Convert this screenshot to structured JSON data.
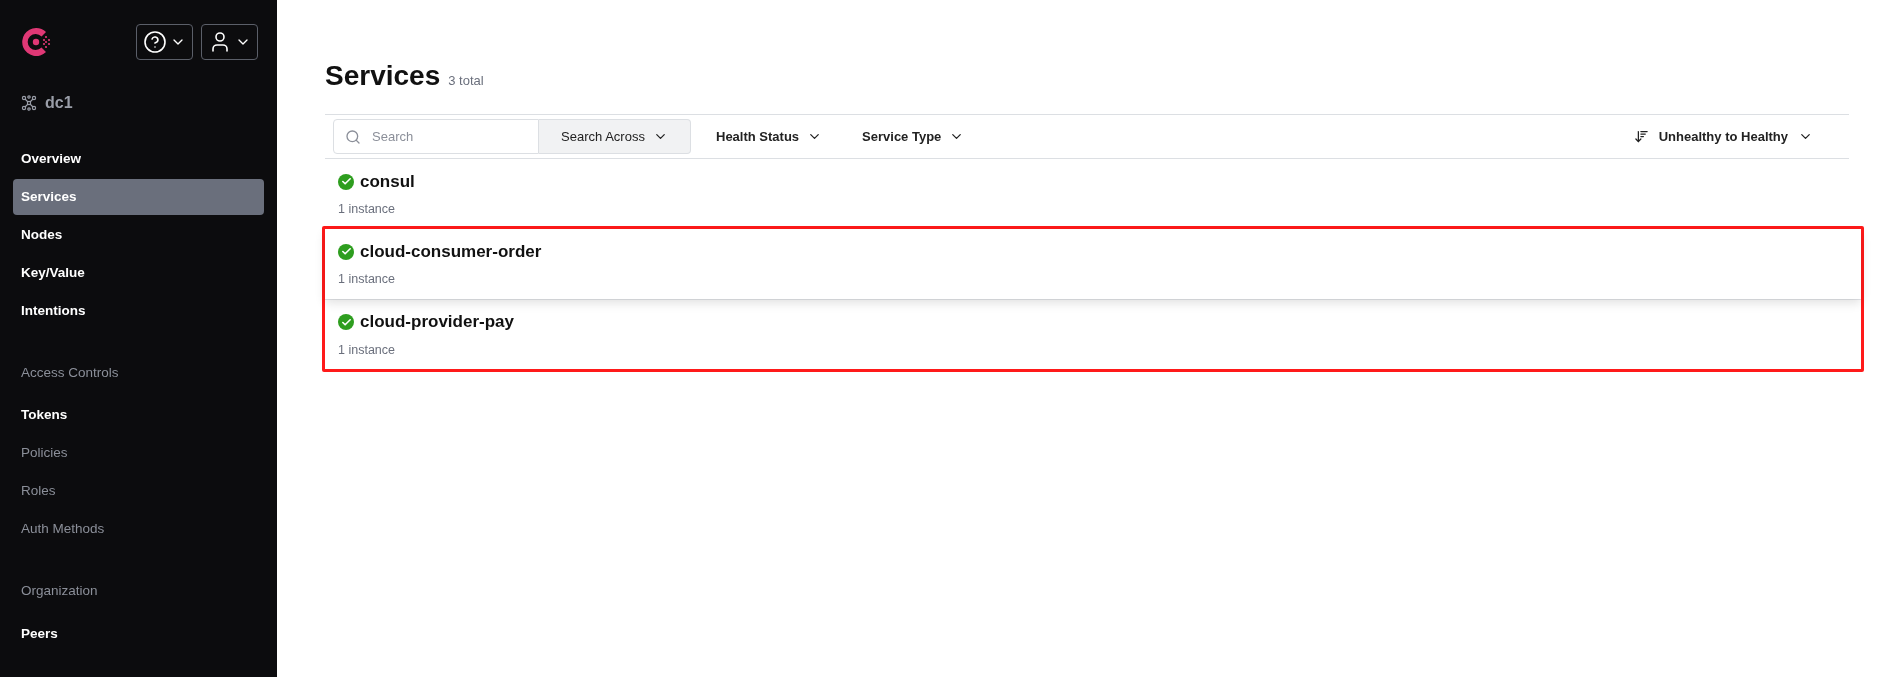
{
  "sidebar": {
    "datacenter": "dc1",
    "items": [
      {
        "kind": "link",
        "label": "Overview",
        "selected": false,
        "disabled": false
      },
      {
        "kind": "link",
        "label": "Services",
        "selected": true,
        "disabled": false
      },
      {
        "kind": "link",
        "label": "Nodes",
        "selected": false,
        "disabled": false
      },
      {
        "kind": "link",
        "label": "Key/Value",
        "selected": false,
        "disabled": false
      },
      {
        "kind": "link",
        "label": "Intentions",
        "selected": false,
        "disabled": false
      },
      {
        "kind": "header",
        "label": "Access Controls"
      },
      {
        "kind": "link",
        "label": "Tokens",
        "selected": false,
        "disabled": false
      },
      {
        "kind": "link",
        "label": "Policies",
        "selected": false,
        "disabled": true
      },
      {
        "kind": "link",
        "label": "Roles",
        "selected": false,
        "disabled": true
      },
      {
        "kind": "link",
        "label": "Auth Methods",
        "selected": false,
        "disabled": true
      },
      {
        "kind": "header",
        "label": "Organization"
      },
      {
        "kind": "link",
        "label": "Peers",
        "selected": false,
        "disabled": false
      }
    ]
  },
  "page": {
    "title": "Services",
    "count": "3 total"
  },
  "toolbar": {
    "search": {
      "placeholder": "Search"
    },
    "search_across": "Search Across",
    "filters": [
      "Health Status",
      "Service Type"
    ],
    "sort": "Unhealthy to Healthy"
  },
  "services": [
    {
      "name": "consul",
      "instances": "1 instance",
      "healthy": true,
      "hovered": false,
      "highlighted": false
    },
    {
      "name": "cloud-consumer-order",
      "instances": "1 instance",
      "healthy": true,
      "hovered": true,
      "highlighted": true
    },
    {
      "name": "cloud-provider-pay",
      "instances": "1 instance",
      "healthy": true,
      "hovered": false,
      "highlighted": true
    }
  ],
  "annotation": {
    "color": "#ff1a1a"
  }
}
